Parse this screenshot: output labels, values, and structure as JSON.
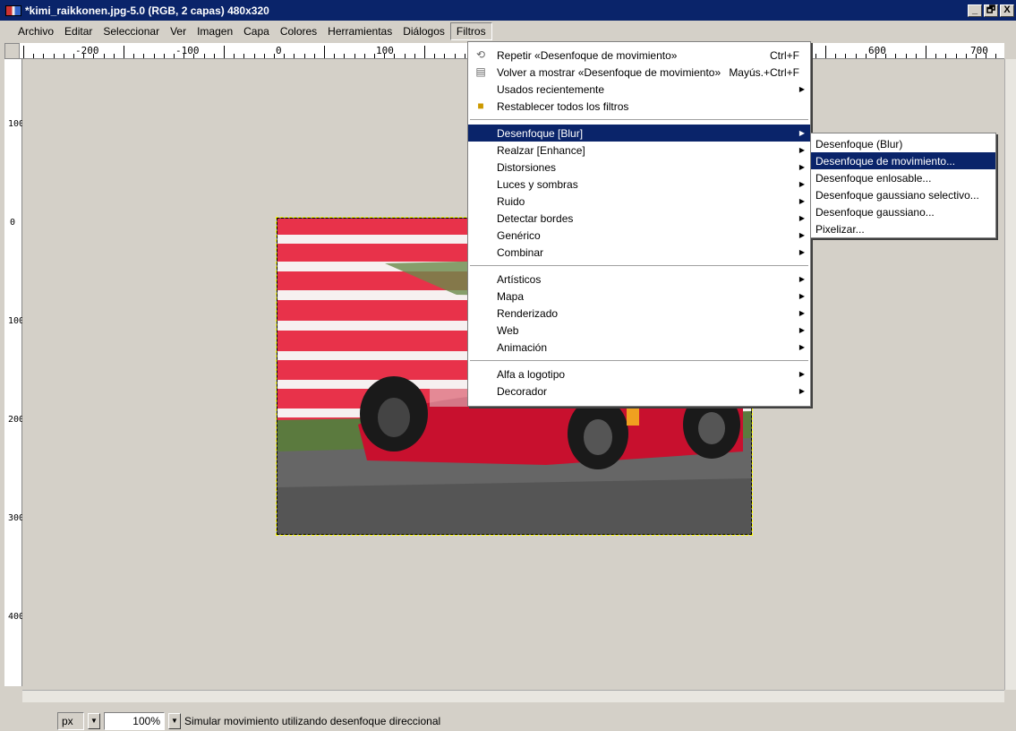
{
  "window": {
    "title": "*kimi_raikkonen.jpg-5.0 (RGB, 2 capas) 480x320",
    "btn_min": "_",
    "btn_max": "🗗",
    "btn_close": "X"
  },
  "menubar": {
    "items": [
      "Archivo",
      "Editar",
      "Seleccionar",
      "Ver",
      "Imagen",
      "Capa",
      "Colores",
      "Herramientas",
      "Diálogos",
      "Filtros"
    ]
  },
  "ruler": {
    "h_labels": [
      "-200",
      "-100",
      "0",
      "100",
      "600",
      "700"
    ],
    "v_labels": [
      "100",
      "0",
      "100",
      "200",
      "300",
      "400"
    ]
  },
  "filters_menu": {
    "top": [
      {
        "label": "Repetir «Desenfoque de movimiento»",
        "shortcut": "Ctrl+F",
        "icon": "repeat-icon"
      },
      {
        "label": "Volver a mostrar «Desenfoque de movimiento»",
        "shortcut": "Mayús.+Ctrl+F",
        "icon": "reshow-icon"
      },
      {
        "label": "Usados recientemente",
        "shortcut": "",
        "icon": ""
      },
      {
        "label": "Restablecer todos los filtros",
        "shortcut": "",
        "icon": "reset-icon"
      }
    ],
    "group1": [
      "Desenfoque [Blur]",
      "Realzar [Enhance]",
      "Distorsiones",
      "Luces y sombras",
      "Ruido",
      "Detectar bordes",
      "Genérico",
      "Combinar"
    ],
    "group2": [
      "Artísticos",
      "Mapa",
      "Renderizado",
      "Web",
      "Animación"
    ],
    "group3": [
      "Alfa a logotipo",
      "Decorador"
    ],
    "highlighted": "Desenfoque [Blur]"
  },
  "blur_submenu": {
    "items": [
      "Desenfoque (Blur)",
      "Desenfoque de movimiento...",
      "Desenfoque enlosable...",
      "Desenfoque gaussiano selectivo...",
      "Desenfoque gaussiano...",
      "Pixelizar..."
    ],
    "highlighted": "Desenfoque de movimiento..."
  },
  "statusbar": {
    "unit": "px",
    "zoom": "100%",
    "message": "Simular movimiento utilizando desenfoque direccional"
  },
  "colors": {
    "titlebar": "#0a246a",
    "highlight": "#0a246a",
    "bg": "#d4d0c8",
    "car_red": "#c8102e"
  }
}
